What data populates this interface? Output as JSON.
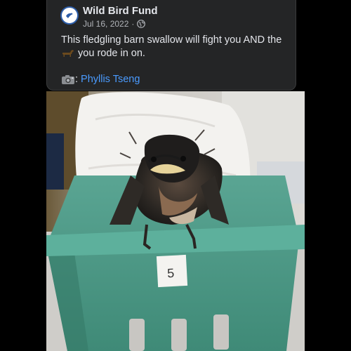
{
  "post": {
    "author": "Wild Bird Fund",
    "date": "Jul 16, 2022",
    "separator": "·",
    "text_before_emoji": "This fledgling barn swallow will fight you AND the",
    "text_after_emoji": "you rode in on.",
    "emoji_icon": "horse-icon",
    "credit_icon": "camera-icon",
    "credit_separator": ":",
    "photographer": "Phyllis Tseng",
    "privacy_icon": "globe-icon"
  },
  "photo": {
    "box_label": "5"
  },
  "colors": {
    "card_bg": "#242526",
    "link": "#4a9bff",
    "text": "#e4e6eb",
    "meta": "#b0b3b8",
    "box_green": "#4f9a86"
  }
}
